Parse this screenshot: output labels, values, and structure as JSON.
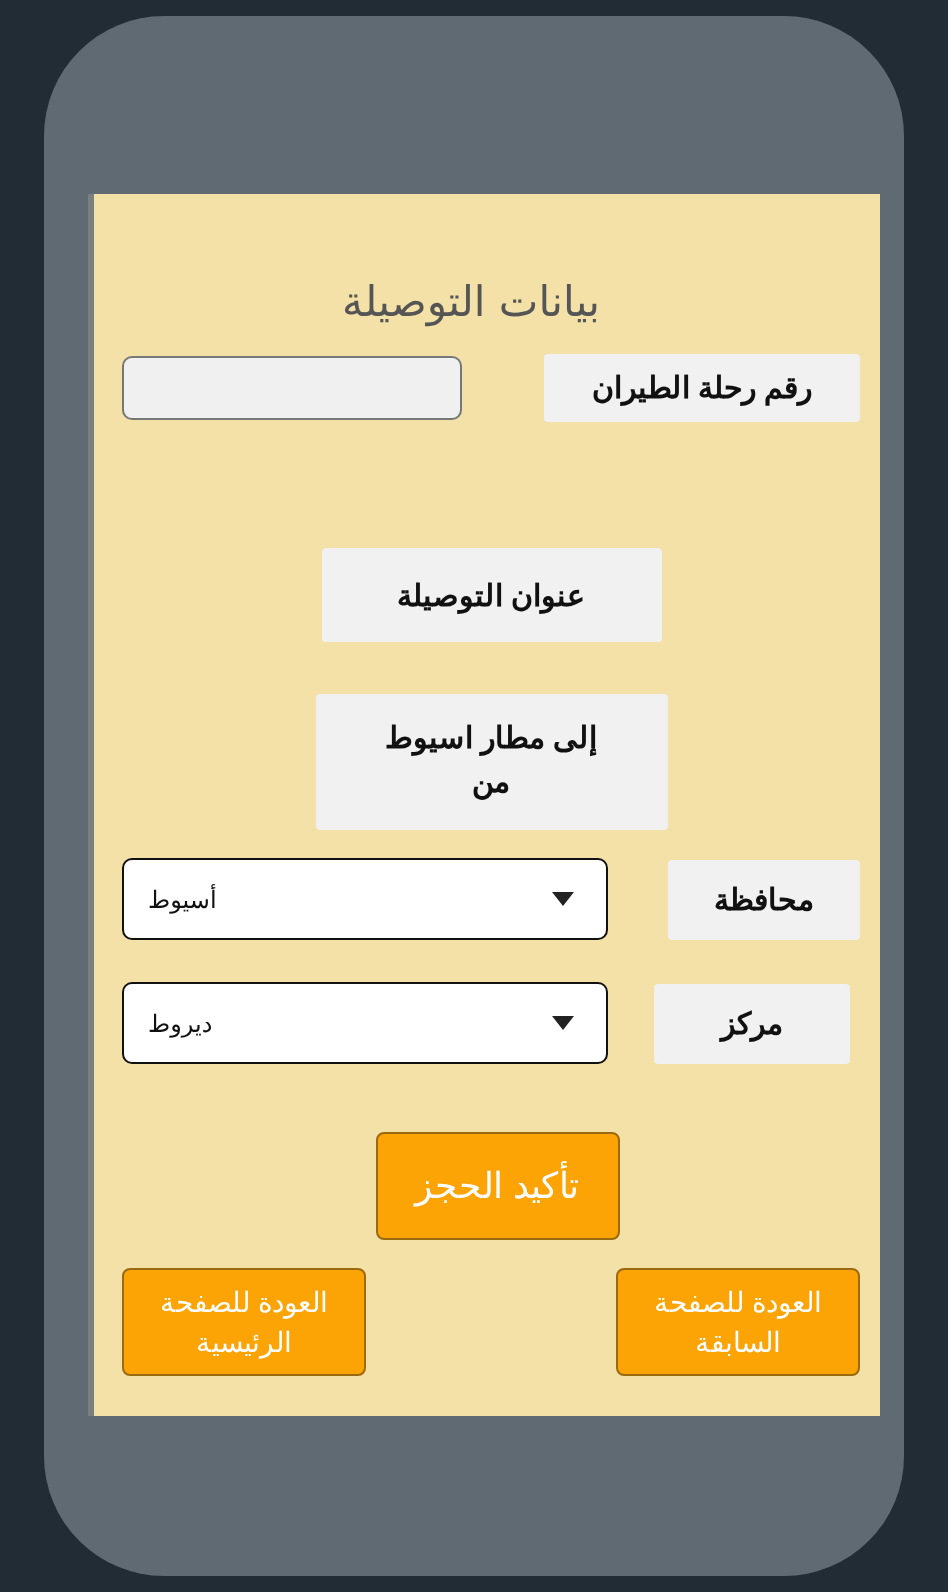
{
  "title": "بيانات التوصيلة",
  "flight": {
    "label": "رقم رحلة الطيران"
  },
  "address_heading": "عنوان التوصيلة",
  "from_note": "إلى مطار اسيوط\nمن",
  "selects": [
    {
      "label": "محافظة",
      "value": "أسيوط"
    },
    {
      "label": "مركز",
      "value": "ديروط"
    }
  ],
  "confirm_button": "تأكيد الحجز",
  "nav_buttons": [
    {
      "label": "العودة للصفحة السابقة"
    },
    {
      "label": "العودة للصفحة الرئيسية"
    }
  ]
}
